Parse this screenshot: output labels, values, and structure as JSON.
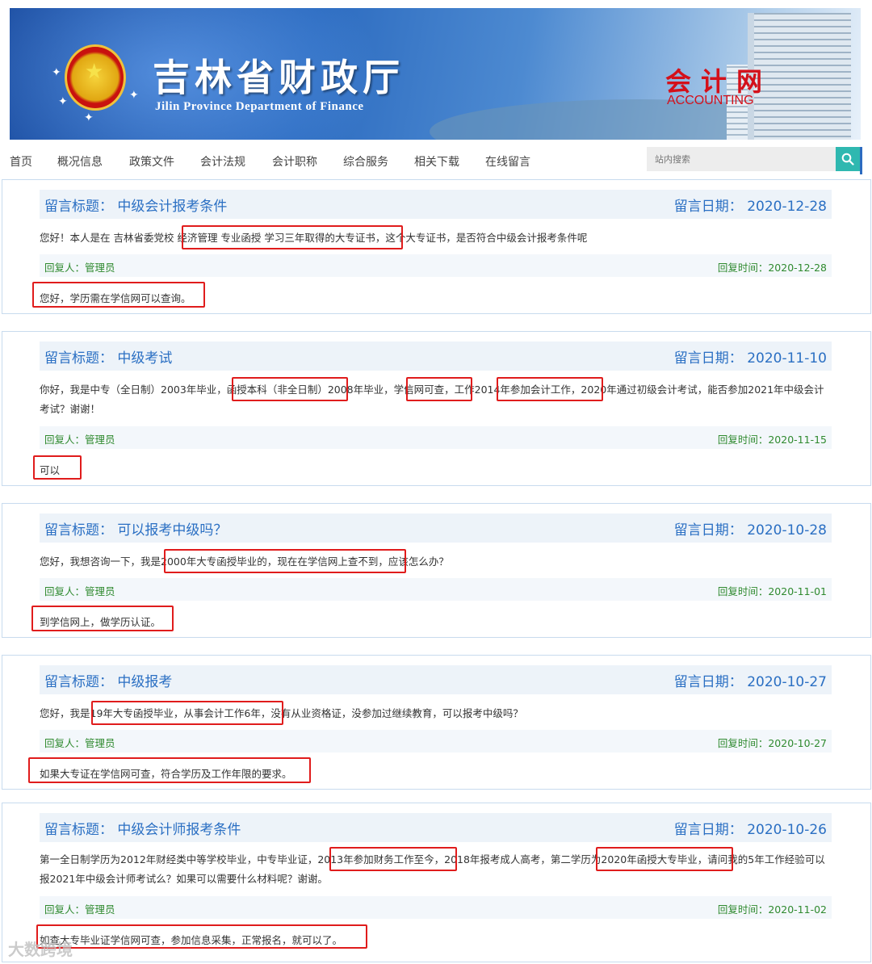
{
  "header": {
    "title_cn": "吉林省财政厅",
    "title_en": "Jilin Province Department of Finance",
    "section_cn": "会计网",
    "section_en": "ACCOUNTING"
  },
  "nav": [
    "首页",
    "概况信息",
    "政策文件",
    "会计法规",
    "会计职称",
    "综合服务",
    "相关下载",
    "在线留言"
  ],
  "search": {
    "placeholder": "站内搜索"
  },
  "labels": {
    "title_prefix": "留言标题：",
    "date_prefix": "留言日期：",
    "replier_prefix": "回复人：",
    "reply_time_prefix": "回复时间："
  },
  "messages": [
    {
      "title": "中级会计报考条件",
      "date": "2020-12-28",
      "question": "您好！本人是在 吉林省委党校 经济管理 专业函授 学习三年取得的大专证书，这个大专证书，是否符合中级会计报考条件呢",
      "replier": "管理员",
      "reply_time": "2020-12-28",
      "answer": "您好，学历需在学信网可以查询。"
    },
    {
      "title": "中级考试",
      "date": "2020-11-10",
      "question": "你好，我是中专（全日制）2003年毕业，函授本科（非全日制）2008年毕业，学信网可查，工作2014年参加会计工作，2020年通过初级会计考试，能否参加2021年中级会计考试？谢谢！",
      "replier": "管理员",
      "reply_time": "2020-11-15",
      "answer": "可以"
    },
    {
      "title": "可以报考中级吗？",
      "date": "2020-10-28",
      "question": "您好，我想咨询一下，我是2000年大专函授毕业的，现在在学信网上查不到，应该怎么办？",
      "replier": "管理员",
      "reply_time": "2020-11-01",
      "answer": "到学信网上，做学历认证。"
    },
    {
      "title": "中级报考",
      "date": "2020-10-27",
      "question": "您好，我是19年大专函授毕业，从事会计工作6年，没有从业资格证，没参加过继续教育，可以报考中级吗？",
      "replier": "管理员",
      "reply_time": "2020-10-27",
      "answer": "如果大专证在学信网可查，符合学历及工作年限的要求。"
    },
    {
      "title": "中级会计师报考条件",
      "date": "2020-10-26",
      "question": "第一全日制学历为2012年财经类中等学校毕业，中专毕业证，2013年参加财务工作至今，2018年报考成人高考，第二学历为2020年函授大专毕业，请问我的5年工作经验可以报2021年中级会计师考试么？如果可以需要什么材料呢？谢谢。",
      "replier": "管理员",
      "reply_time": "2020-11-02",
      "answer": "如查大专毕业证学信网可查，参加信息采集，正常报名，就可以了。"
    }
  ],
  "watermark": "大数跨境"
}
